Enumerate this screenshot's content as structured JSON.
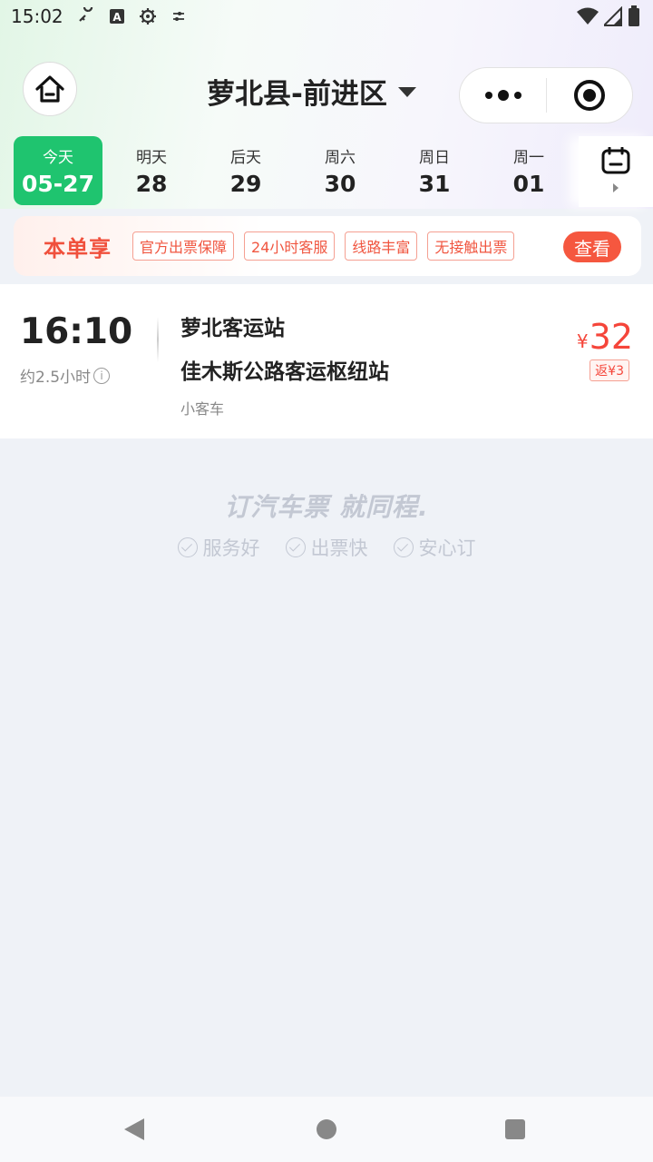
{
  "status_bar": {
    "time": "15:02",
    "icons": [
      "vpn-key-icon",
      "font-icon",
      "settings-icon",
      "tune-icon"
    ],
    "right_icons": [
      "wifi-icon",
      "signal-icon",
      "battery-icon"
    ]
  },
  "header": {
    "title": "萝北县-前进区"
  },
  "dates": [
    {
      "label": "今天",
      "num": "05-27",
      "active": true
    },
    {
      "label": "明天",
      "num": "28",
      "active": false
    },
    {
      "label": "后天",
      "num": "29",
      "active": false
    },
    {
      "label": "周六",
      "num": "30",
      "active": false
    },
    {
      "label": "周日",
      "num": "31",
      "active": false
    },
    {
      "label": "周一",
      "num": "01",
      "active": false
    }
  ],
  "promo": {
    "title": "本单享",
    "tags": [
      "官方出票保障",
      "24小时客服",
      "线路丰富",
      "无接触出票"
    ],
    "button": "查看"
  },
  "trip": {
    "time": "16:10",
    "duration": "约2.5小时",
    "from": "萝北客运站",
    "to": "佳木斯公路客运枢纽站",
    "vehicle": "小客车",
    "currency": "¥",
    "price": "32",
    "rebate": "返¥3"
  },
  "slogan": {
    "text": "订汽车票 就同程.",
    "features": [
      "服务好",
      "出票快",
      "安心订"
    ]
  },
  "colors": {
    "accent_green": "#1fc46f",
    "price_red": "#f5453a",
    "promo_red": "#f0503c"
  }
}
